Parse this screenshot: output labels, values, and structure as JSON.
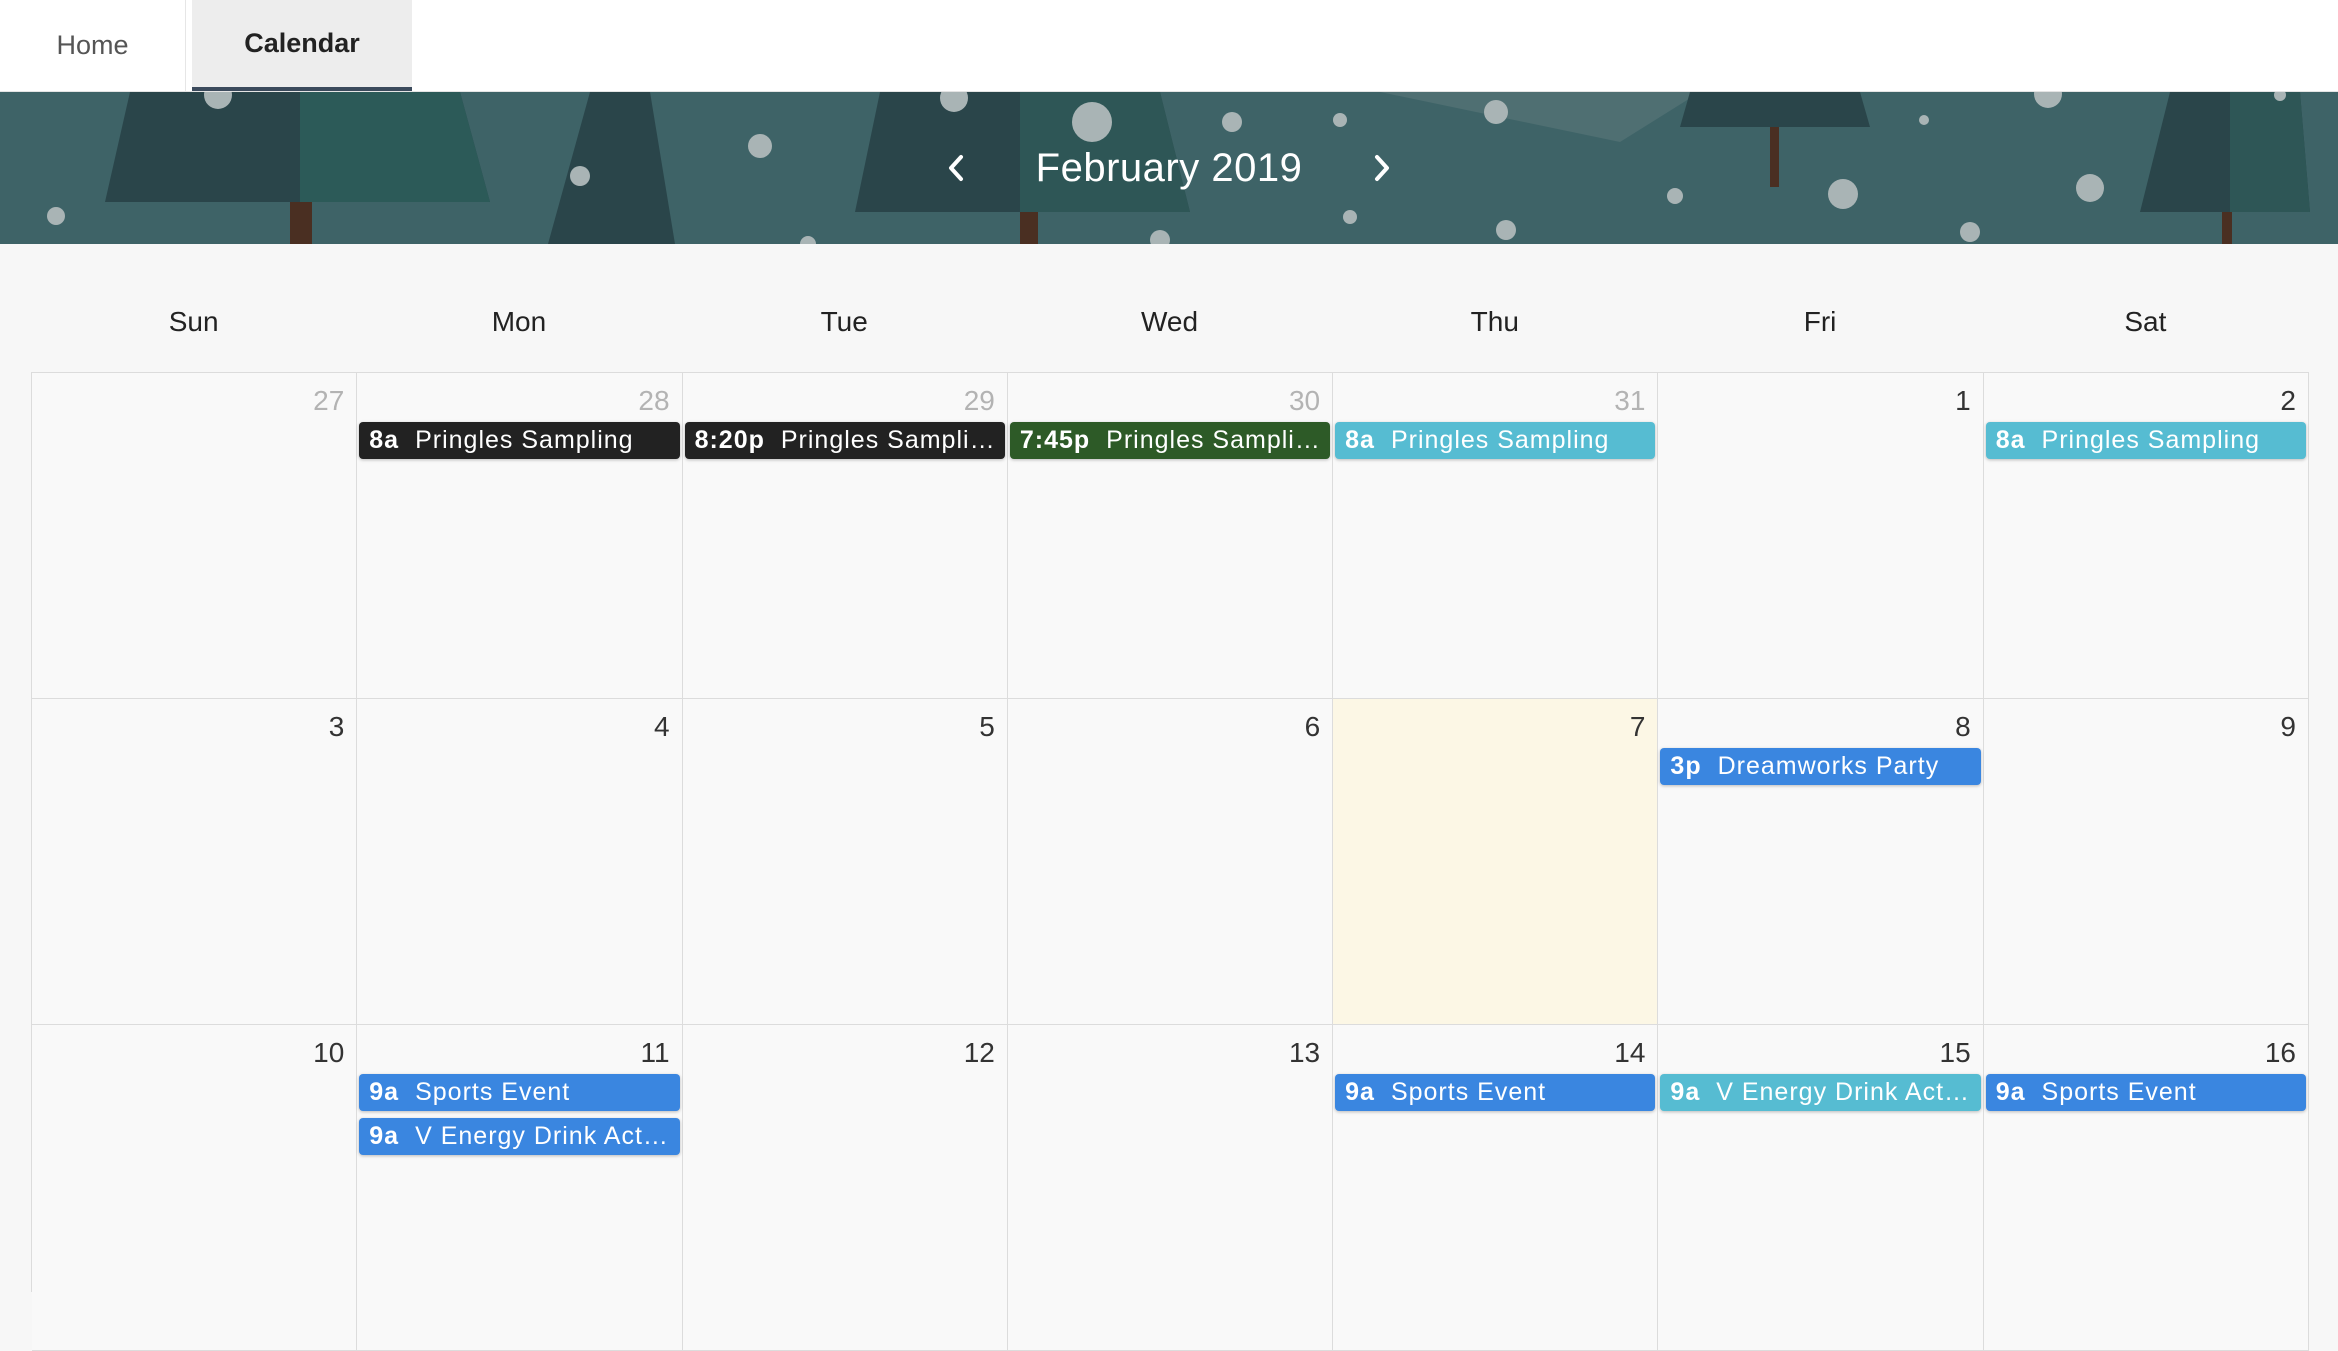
{
  "tabs": [
    {
      "label": "Home",
      "active": false
    },
    {
      "label": "Calendar",
      "active": true
    }
  ],
  "header": {
    "month_title": "February 2019",
    "prev_icon": "chevron-left-icon",
    "next_icon": "chevron-right-icon"
  },
  "weekdays": [
    "Sun",
    "Mon",
    "Tue",
    "Wed",
    "Thu",
    "Fri",
    "Sat"
  ],
  "colors": {
    "dark": "#222222",
    "green": "#2d5a27",
    "teal": "#56bcd2",
    "blue": "#3a86e0",
    "today_bg": "#fcf7e5",
    "banner": "#3e6367"
  },
  "weeks": [
    [
      {
        "day": "27",
        "other_month": true,
        "events": []
      },
      {
        "day": "28",
        "other_month": true,
        "events": [
          {
            "time": "8a",
            "title": "Pringles Sampling",
            "color": "#222222"
          }
        ]
      },
      {
        "day": "29",
        "other_month": true,
        "events": [
          {
            "time": "8:20p",
            "title": "Pringles Sampling",
            "color": "#222222"
          }
        ]
      },
      {
        "day": "30",
        "other_month": true,
        "events": [
          {
            "time": "7:45p",
            "title": "Pringles Sampling",
            "color": "#2d5a27"
          }
        ]
      },
      {
        "day": "31",
        "other_month": true,
        "events": [
          {
            "time": "8a",
            "title": "Pringles Sampling",
            "color": "#56bcd2"
          }
        ]
      },
      {
        "day": "1",
        "other_month": false,
        "events": []
      },
      {
        "day": "2",
        "other_month": false,
        "events": [
          {
            "time": "8a",
            "title": "Pringles Sampling",
            "color": "#56bcd2"
          }
        ]
      }
    ],
    [
      {
        "day": "3",
        "other_month": false,
        "events": []
      },
      {
        "day": "4",
        "other_month": false,
        "events": []
      },
      {
        "day": "5",
        "other_month": false,
        "events": []
      },
      {
        "day": "6",
        "other_month": false,
        "events": []
      },
      {
        "day": "7",
        "other_month": false,
        "today": true,
        "events": []
      },
      {
        "day": "8",
        "other_month": false,
        "events": [
          {
            "time": "3p",
            "title": "Dreamworks Party",
            "color": "#3a86e0"
          }
        ]
      },
      {
        "day": "9",
        "other_month": false,
        "events": []
      }
    ],
    [
      {
        "day": "10",
        "other_month": false,
        "events": []
      },
      {
        "day": "11",
        "other_month": false,
        "events": [
          {
            "time": "9a",
            "title": "Sports Event",
            "color": "#3a86e0"
          },
          {
            "time": "9a",
            "title": "V Energy Drink Acti…",
            "color": "#3a86e0"
          }
        ]
      },
      {
        "day": "12",
        "other_month": false,
        "events": []
      },
      {
        "day": "13",
        "other_month": false,
        "events": []
      },
      {
        "day": "14",
        "other_month": false,
        "events": [
          {
            "time": "9a",
            "title": "Sports Event",
            "color": "#3a86e0"
          }
        ]
      },
      {
        "day": "15",
        "other_month": false,
        "events": [
          {
            "time": "9a",
            "title": "V Energy Drink Acti…",
            "color": "#56bcd2"
          }
        ]
      },
      {
        "day": "16",
        "other_month": false,
        "events": [
          {
            "time": "9a",
            "title": "Sports Event",
            "color": "#3a86e0"
          }
        ]
      }
    ]
  ]
}
